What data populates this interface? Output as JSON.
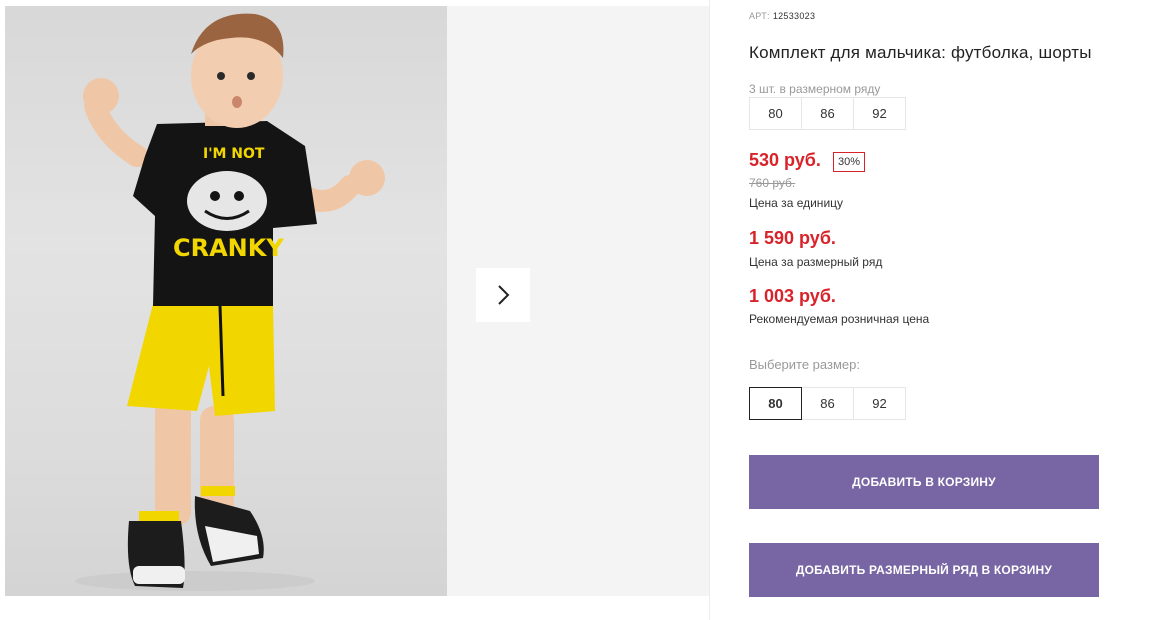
{
  "product": {
    "art_label": "АРТ:",
    "art_number": "12533023",
    "title": "Комплект для мальчика: футболка, шорты"
  },
  "size_row": {
    "label": "3 шт. в размерном ряду",
    "sizes": [
      "80",
      "86",
      "92"
    ]
  },
  "prices": {
    "unit_price": "530 руб.",
    "discount": "30%",
    "old_price": "760 руб.",
    "unit_label": "Цена за единицу",
    "row_price": "1 590 руб.",
    "row_label": "Цена за размерный ряд",
    "retail_price": "1 003 руб.",
    "retail_label": "Рекомендуемая розничная цена"
  },
  "size_select": {
    "label": "Выберите размер:",
    "options": [
      "80",
      "86",
      "92"
    ],
    "selected": "80"
  },
  "buttons": {
    "add_to_cart": "ДОБАВИТЬ В КОРЗИНУ",
    "add_row_to_cart": "ДОБАВИТЬ РАЗМЕРНЫЙ РЯД В КОРЗИНУ"
  },
  "photo_print": {
    "line1": "I'M NOT",
    "line2": "CRANKY"
  },
  "colors": {
    "accent_price": "#d8232a",
    "button_bg": "#7866a4",
    "shorts_yellow": "#f2d600",
    "shirt_black": "#141414"
  },
  "icons": {
    "gallery_next": "chevron-right-icon"
  }
}
